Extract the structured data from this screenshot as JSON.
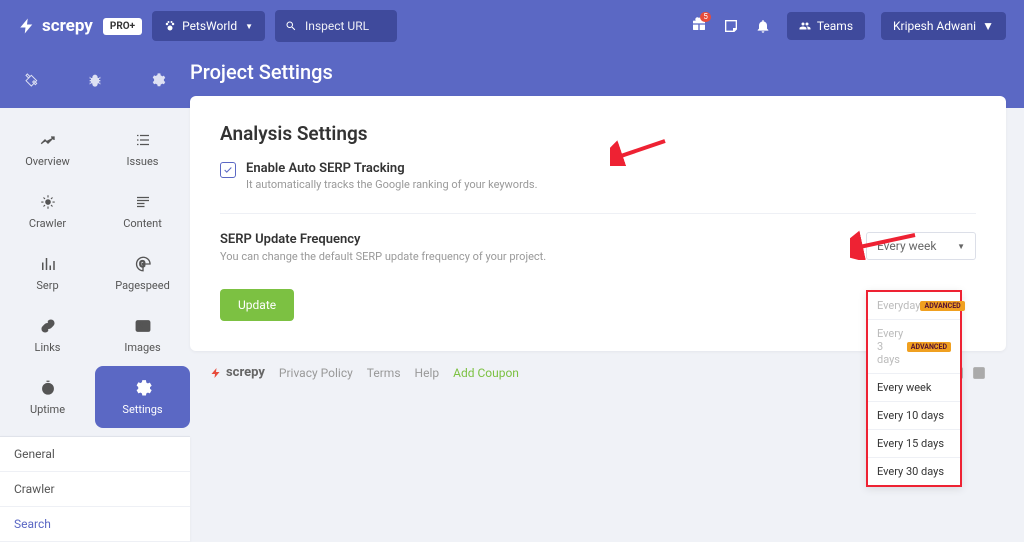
{
  "brand": {
    "name": "screpy",
    "badge": "PRO+"
  },
  "topbar": {
    "project": "PetsWorld",
    "search_placeholder": "Inspect URL",
    "gift_count": "5",
    "teams_label": "Teams",
    "user_name": "Kripesh Adwani"
  },
  "header": {
    "title": "Project Settings"
  },
  "sidebar": {
    "items": [
      {
        "label": "Overview"
      },
      {
        "label": "Issues"
      },
      {
        "label": "Crawler"
      },
      {
        "label": "Content"
      },
      {
        "label": "Serp"
      },
      {
        "label": "Pagespeed"
      },
      {
        "label": "Links"
      },
      {
        "label": "Images"
      },
      {
        "label": "Uptime"
      },
      {
        "label": "Settings"
      }
    ],
    "sub": [
      {
        "label": "General"
      },
      {
        "label": "Crawler"
      },
      {
        "label": "Search"
      }
    ]
  },
  "card": {
    "title": "Analysis Settings",
    "checkbox_label": "Enable Auto SERP Tracking",
    "checkbox_desc": "It automatically tracks the Google ranking of your keywords.",
    "freq_title": "SERP Update Frequency",
    "freq_desc": "You can change the default SERP update frequency of your project.",
    "select_value": "Every week",
    "dropdown": [
      {
        "label": "Everyday",
        "badge": "ADVANCED",
        "disabled": true
      },
      {
        "label": "Every 3 days",
        "badge": "ADVANCED",
        "disabled": true
      },
      {
        "label": "Every week"
      },
      {
        "label": "Every 10 days"
      },
      {
        "label": "Every 15 days"
      },
      {
        "label": "Every 30 days"
      }
    ],
    "update_btn": "Update"
  },
  "footer": {
    "brand": "screpy",
    "links": [
      "Privacy Policy",
      "Terms",
      "Help"
    ],
    "coupon": "Add Coupon"
  }
}
